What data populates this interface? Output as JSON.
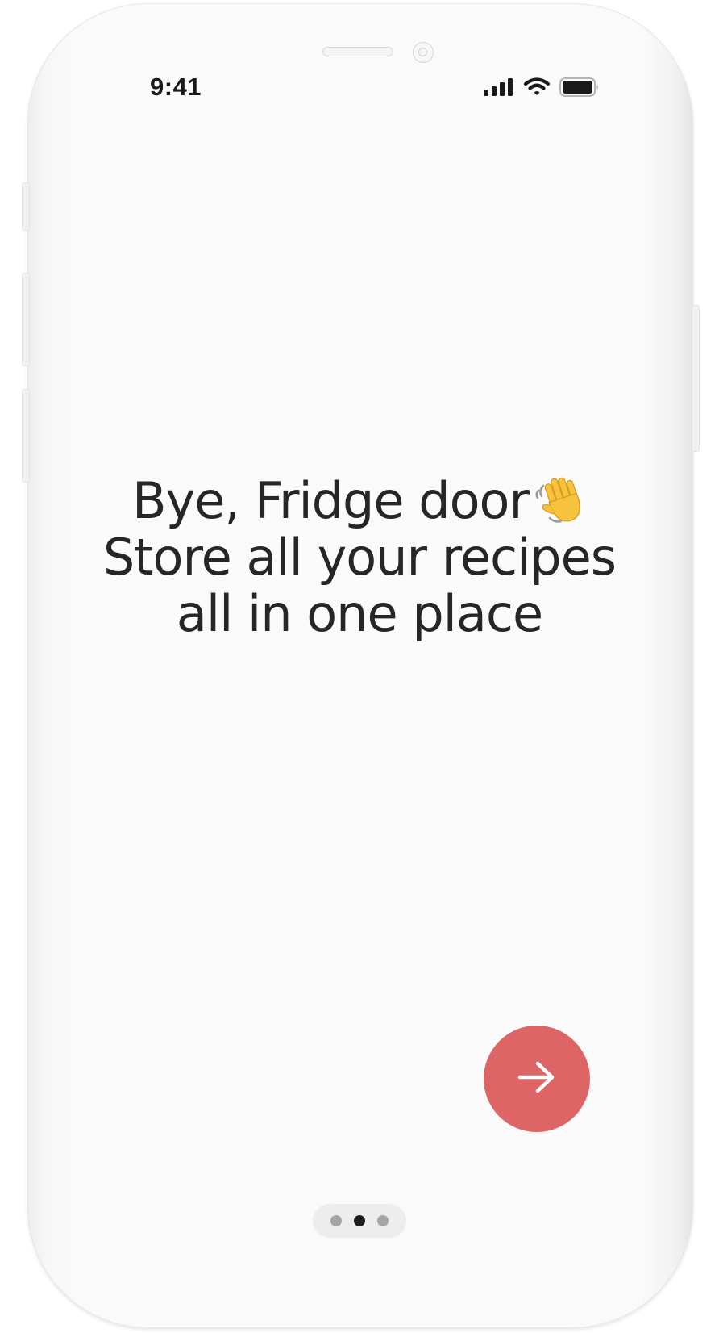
{
  "status_bar": {
    "time": "9:41",
    "icons": [
      "cellular-signal-icon",
      "wifi-icon",
      "battery-icon"
    ]
  },
  "onboarding": {
    "headline_lines": [
      "Bye, Fridge door",
      "Store all your recipes",
      "all in one place"
    ],
    "headline_emoji": "waving-hand-icon",
    "next_button_icon": "arrow-right-icon",
    "pager": {
      "total": 3,
      "active_index": 1
    }
  },
  "colors": {
    "accent": "#dd6566",
    "text": "#262626",
    "background": "#fafafa",
    "pager_active": "#1e1e1e",
    "pager_inactive": "#a5a5a5"
  }
}
